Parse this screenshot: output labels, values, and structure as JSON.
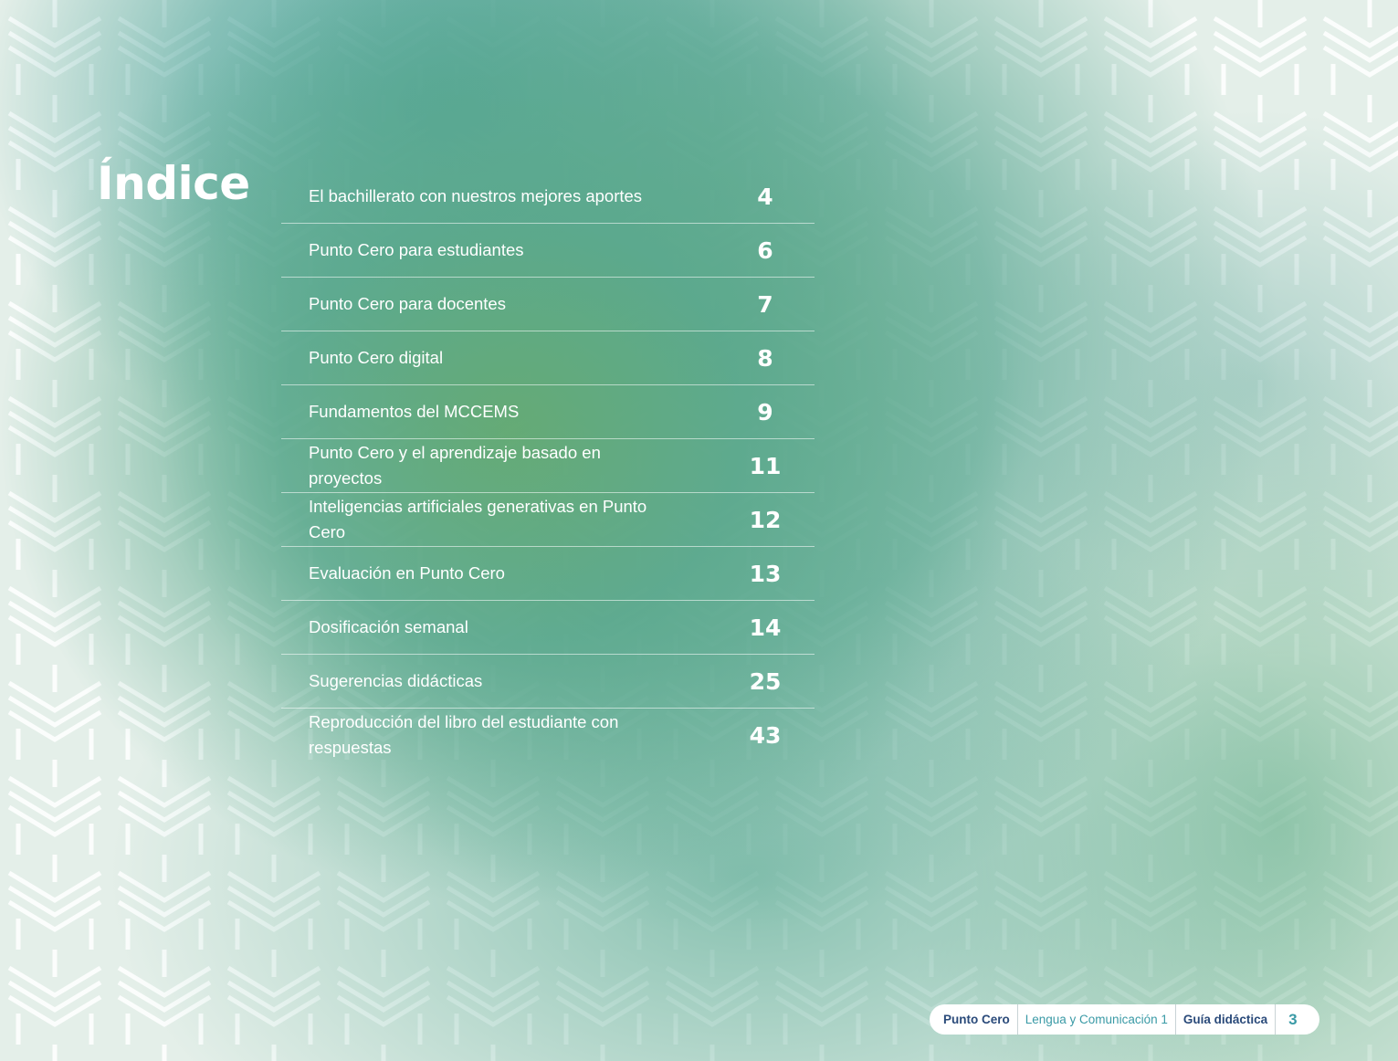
{
  "page": {
    "title": "Índice"
  },
  "toc": [
    {
      "label": "El bachillerato con nuestros mejores aportes",
      "page": "4"
    },
    {
      "label": "Punto Cero para estudiantes",
      "page": "6"
    },
    {
      "label": "Punto Cero para docentes",
      "page": "7"
    },
    {
      "label": "Punto Cero digital",
      "page": "8"
    },
    {
      "label": "Fundamentos del MCCEMS",
      "page": "9"
    },
    {
      "label": "Punto Cero y el aprendizaje basado en proyectos",
      "page": "11"
    },
    {
      "label": "Inteligencias artificiales generativas en Punto Cero",
      "page": "12"
    },
    {
      "label": "Evaluación en Punto Cero",
      "page": "13"
    },
    {
      "label": "Dosificación semanal",
      "page": "14"
    },
    {
      "label": "Sugerencias didácticas",
      "page": "25"
    },
    {
      "label": "Reproducción del libro del estudiante con respuestas",
      "page": "43"
    }
  ],
  "footer": {
    "brand": "Punto Cero",
    "subject": "Lengua y Comunicación 1",
    "guide": "Guía didáctica",
    "page_number": "3"
  },
  "colors": {
    "teal": "#4aa89a",
    "green": "#66ad7e",
    "navy": "#2a4a7a",
    "accent": "#3a9aa6"
  },
  "icons": {
    "background": "geometric-chevron-pattern"
  }
}
